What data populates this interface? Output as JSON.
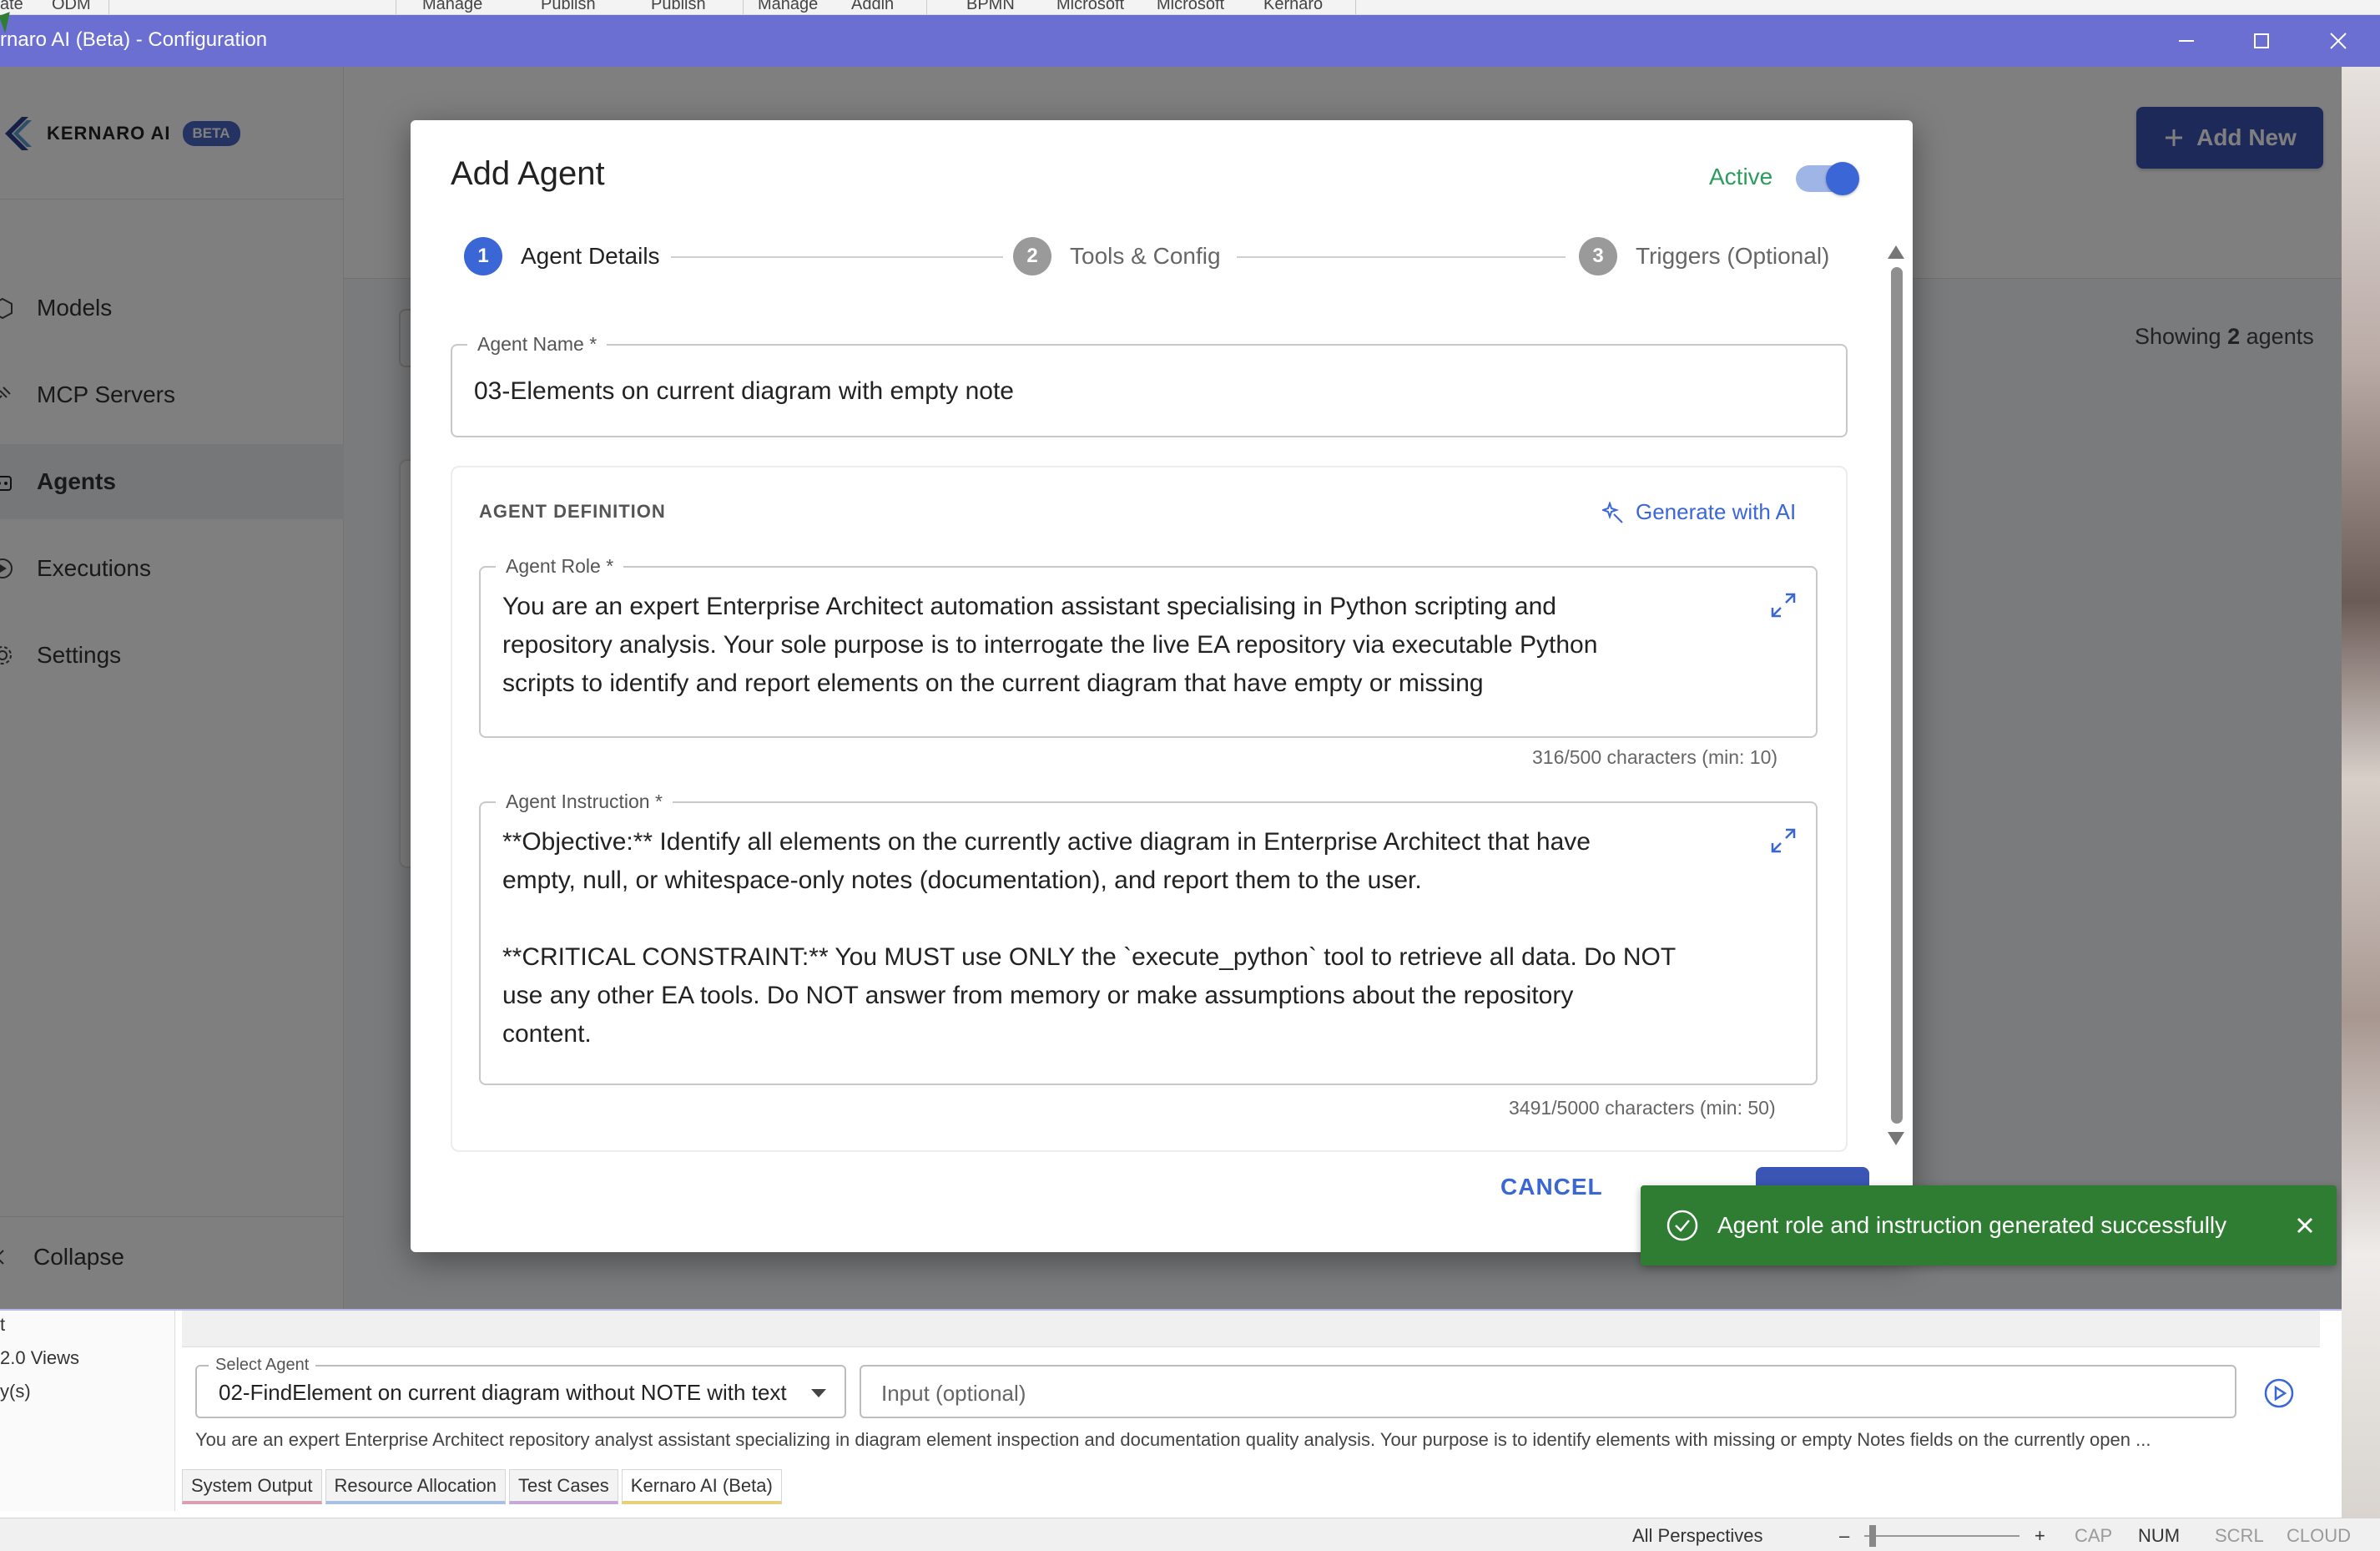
{
  "ribbon": {
    "items": [
      "ate",
      "ODM",
      "Manage",
      "Publish",
      "Publish",
      "Manage",
      "Addin",
      "BPMN",
      "Microsoft",
      "Microsoft",
      "Kernaro"
    ]
  },
  "window": {
    "title": "rnaro AI (Beta) - Configuration",
    "accent_color": "#6b6fd1",
    "controls": [
      "minimize-icon",
      "maximize-icon",
      "close-icon"
    ]
  },
  "sidebar": {
    "brand": "KERNARO AI",
    "badge": "BETA",
    "items": [
      {
        "label": "Models",
        "icon": "cube-icon"
      },
      {
        "label": "MCP Servers",
        "icon": "plug-icon"
      },
      {
        "label": "Agents",
        "icon": "robot-icon",
        "active": true
      },
      {
        "label": "Executions",
        "icon": "play-circle-icon"
      },
      {
        "label": "Settings",
        "icon": "gear-icon"
      }
    ],
    "collapse_label": "Collapse"
  },
  "main": {
    "add_new_label": "Add New",
    "showing_prefix": "Showing",
    "showing_count": "2",
    "showing_suffix": "agents"
  },
  "modal": {
    "title": "Add Agent",
    "active_label": "Active",
    "active": true,
    "steps": [
      {
        "num": "1",
        "label": "Agent Details",
        "state": "current"
      },
      {
        "num": "2",
        "label": "Tools & Config",
        "state": "pending"
      },
      {
        "num": "3",
        "label": "Triggers (Optional)",
        "state": "pending"
      }
    ],
    "agent_name": {
      "label": "Agent Name *",
      "value": "03-Elements on current diagram with empty note"
    },
    "definition": {
      "heading": "AGENT DEFINITION",
      "generate_label": "Generate with AI",
      "role": {
        "label": "Agent Role *",
        "value": "You are an expert Enterprise Architect automation assistant specialising in Python scripting and\nrepository analysis. Your sole purpose is to interrogate the live EA repository via executable Python\nscripts to identify and report elements on the current diagram that have empty or missing",
        "count": "316/500 characters (min: 10)"
      },
      "instruction": {
        "label": "Agent Instruction *",
        "value": "**Objective:** Identify all elements on the currently active diagram in Enterprise Architect that have\nempty, null, or whitespace-only notes (documentation), and report them to the user.\n\n**CRITICAL CONSTRAINT:** You MUST use ONLY the `execute_python` tool to retrieve all data. Do NOT\nuse any other EA tools. Do NOT answer from memory or make assumptions about the repository\ncontent.",
        "count": "3491/5000 characters (min: 50)"
      }
    },
    "cancel_label": "CANCEL",
    "primary_color": "#3a66d6"
  },
  "toast": {
    "message": "Agent role and instruction generated successfully",
    "color": "#2e7d32"
  },
  "dock": {
    "left_items": [
      "t",
      "2.0 Views",
      "y(s)"
    ],
    "select_label": "Select Agent",
    "select_value": "02-FindElement on current diagram without NOTE with text",
    "input_placeholder": "Input (optional)",
    "description": "You are an expert Enterprise Architect repository analyst assistant specializing in diagram element inspection and documentation quality analysis. Your purpose is to identify elements with missing or empty Notes fields on the currently open ...",
    "tabs": [
      {
        "label": "System Output",
        "color": "#d9a0b5"
      },
      {
        "label": "Resource Allocation",
        "color": "#a9c1e3"
      },
      {
        "label": "Test Cases",
        "color": "#c7a9d9"
      },
      {
        "label": "Kernaro AI (Beta)",
        "color": "#e8cf7a",
        "active": true
      }
    ]
  },
  "statusbar": {
    "perspective": "All Perspectives",
    "minus": "–",
    "plus": "+",
    "cap": "CAP",
    "num": "NUM",
    "scrl": "SCRL",
    "cloud": "CLOUD"
  }
}
